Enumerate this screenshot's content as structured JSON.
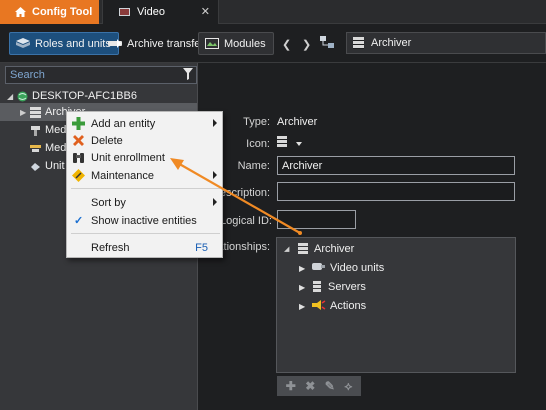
{
  "tabs": {
    "config_tool": "Config Tool",
    "video": "Video",
    "close_glyph": "✕"
  },
  "toolbar": {
    "roles_units": "Roles and units",
    "archive_transfer": "Archive transfer",
    "modules": "Modules",
    "back_glyph": "❮",
    "forward_glyph": "❯",
    "breadcrumb": "Archiver"
  },
  "left": {
    "search_placeholder": "Search",
    "tree": [
      {
        "label": "DESKTOP-AFC1BB6"
      },
      {
        "label": "Archiver"
      },
      {
        "label": "Media"
      },
      {
        "label": "Media"
      },
      {
        "label": "Unit"
      }
    ]
  },
  "properties": {
    "type_label": "Type:",
    "type_value": "Archiver",
    "icon_label": "Icon:",
    "name_label": "Name:",
    "name_value": "Archiver",
    "description_label": "Description:",
    "description_value": "",
    "logical_id_label": "Logical ID:",
    "logical_id_value": "",
    "relationships_label": "Relationships:",
    "relationships": [
      {
        "label": "Archiver"
      },
      {
        "label": "Video units"
      },
      {
        "label": "Servers"
      },
      {
        "label": "Actions"
      }
    ]
  },
  "context_menu": {
    "items": [
      {
        "label": "Add an entity"
      },
      {
        "label": "Delete"
      },
      {
        "label": "Unit enrollment"
      },
      {
        "label": "Maintenance"
      },
      {
        "label": "Sort by"
      },
      {
        "label": "Show inactive entities"
      },
      {
        "label": "Refresh",
        "shortcut": "F5"
      }
    ]
  },
  "colors": {
    "accent_orange": "#e87722",
    "selection_blue": "#1d4f7d",
    "annotation_arrow": "#f08a24"
  }
}
